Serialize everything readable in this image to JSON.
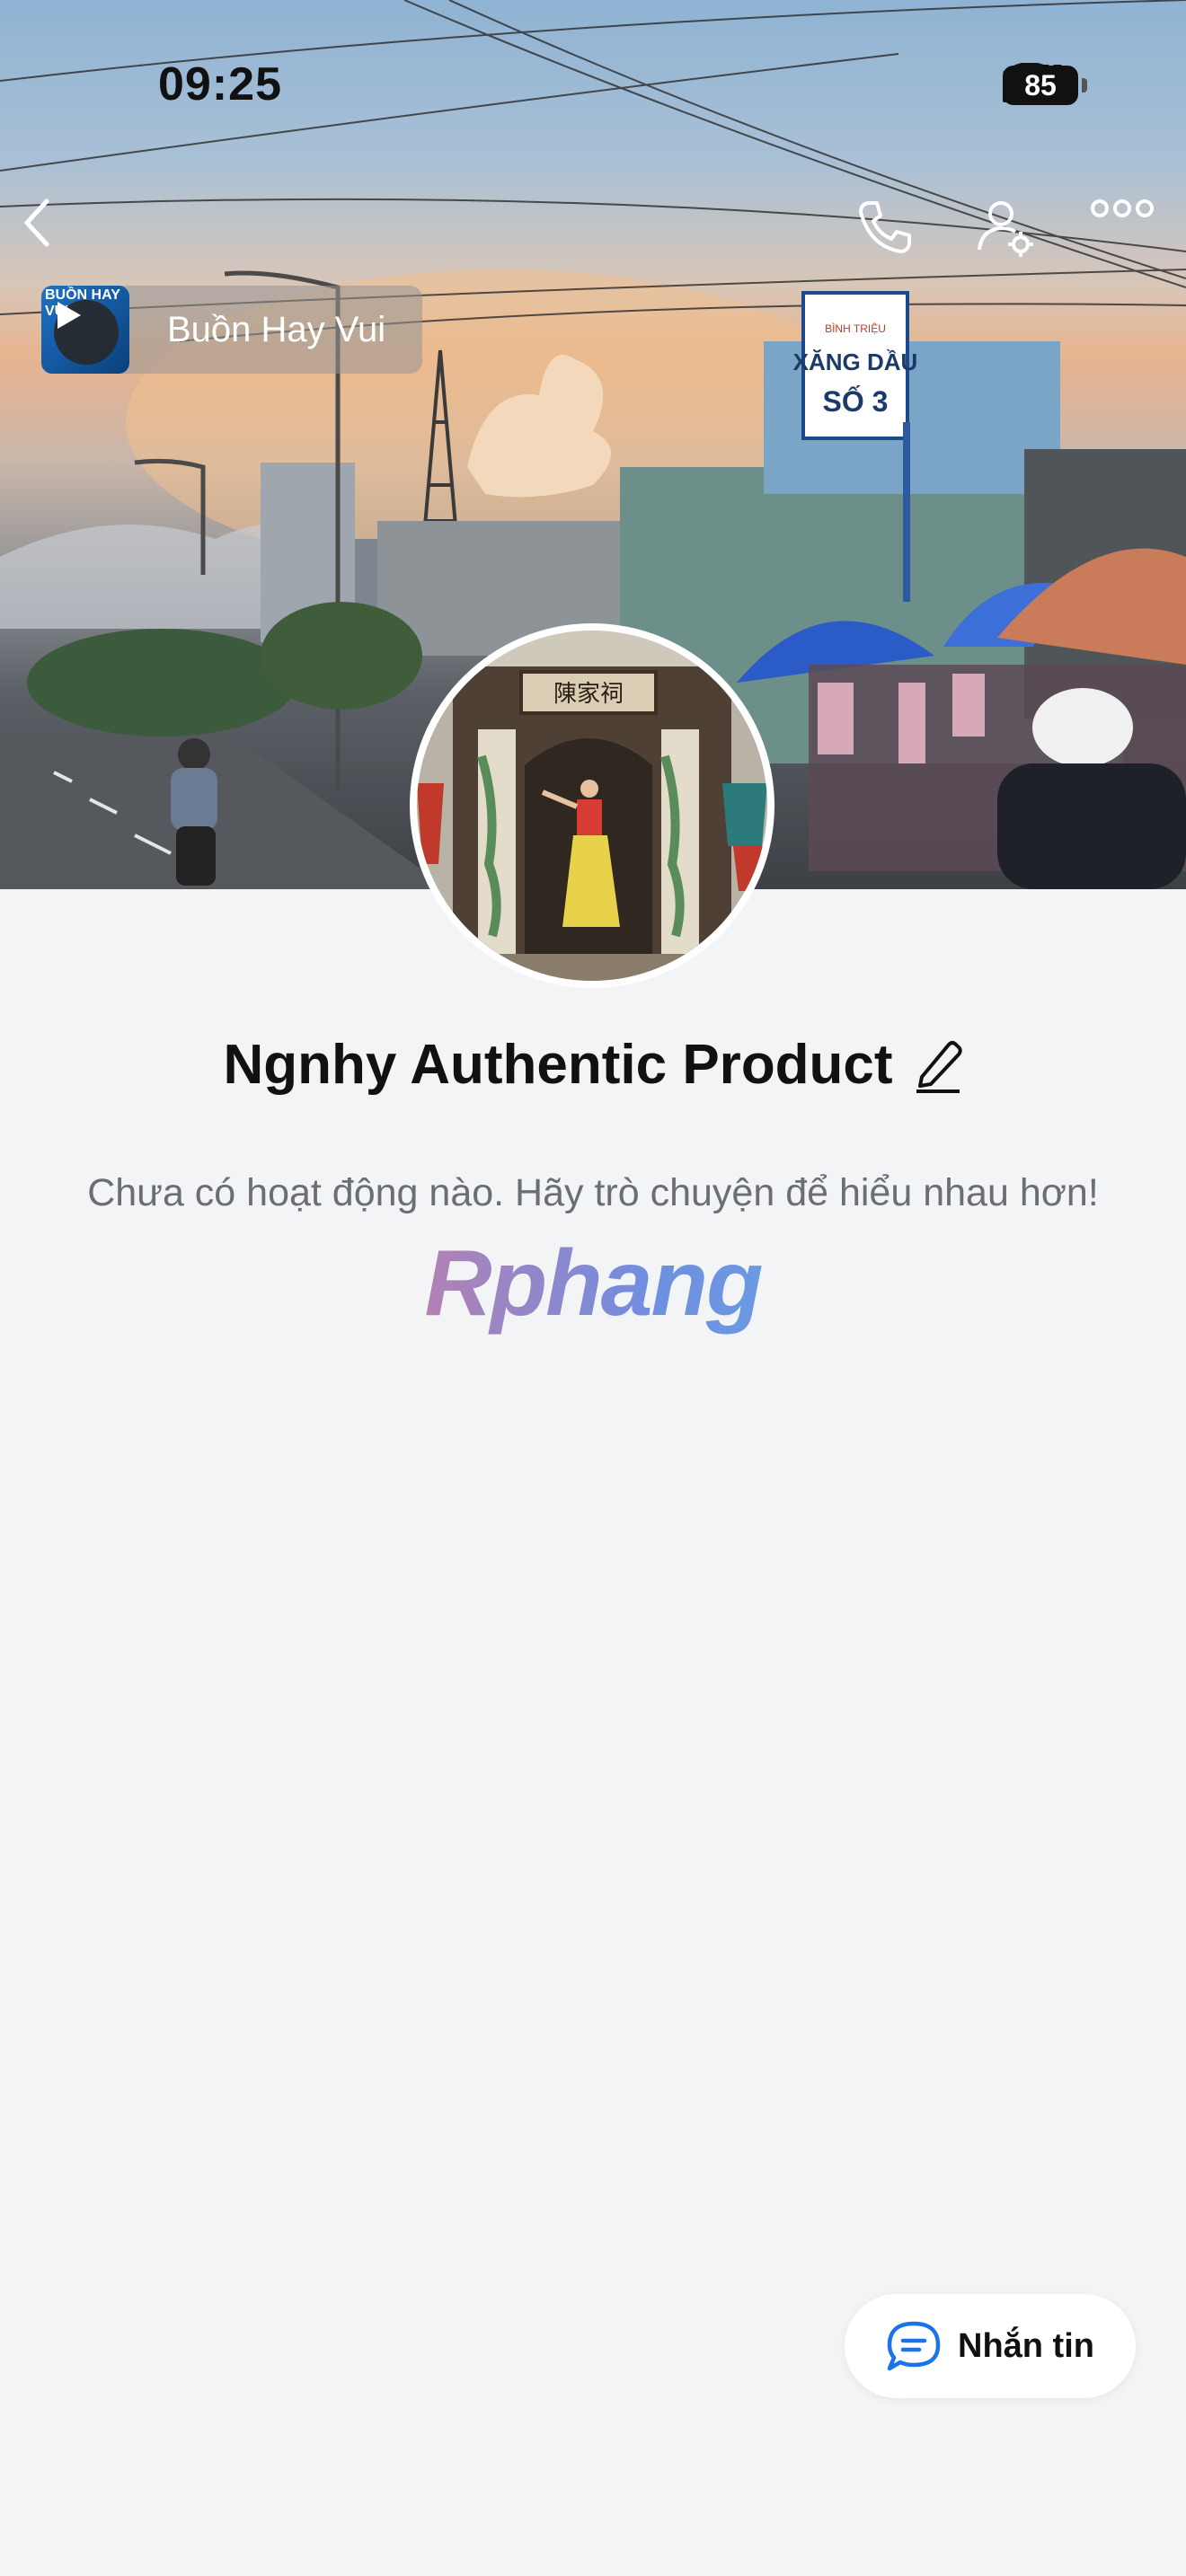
{
  "status_bar": {
    "time": "09:25",
    "battery": "85"
  },
  "nav": {
    "back_icon": "chevron-left-icon",
    "call_icon": "phone-icon",
    "settings_icon": "user-settings-icon",
    "more_icon": "more-dots-icon"
  },
  "music": {
    "title": "Buồn Hay Vui",
    "thumb_text": "BUỒN HAY VUI"
  },
  "cover_sign": {
    "line1": "BÌNH TRIỆU",
    "line2": "XĂNG DẦU",
    "line3": "SỐ 3"
  },
  "avatar_sign": "陳家祠",
  "profile": {
    "name": "Ngnhy Authentic Product",
    "subtitle": "Chưa có hoạt động nào. Hãy trò chuyện để hiểu nhau hơn!",
    "watermark": "Rphang"
  },
  "message_button": {
    "label": "Nhắn tin"
  },
  "colors": {
    "background": "#f3f4f6",
    "accent": "#1a73e8"
  }
}
